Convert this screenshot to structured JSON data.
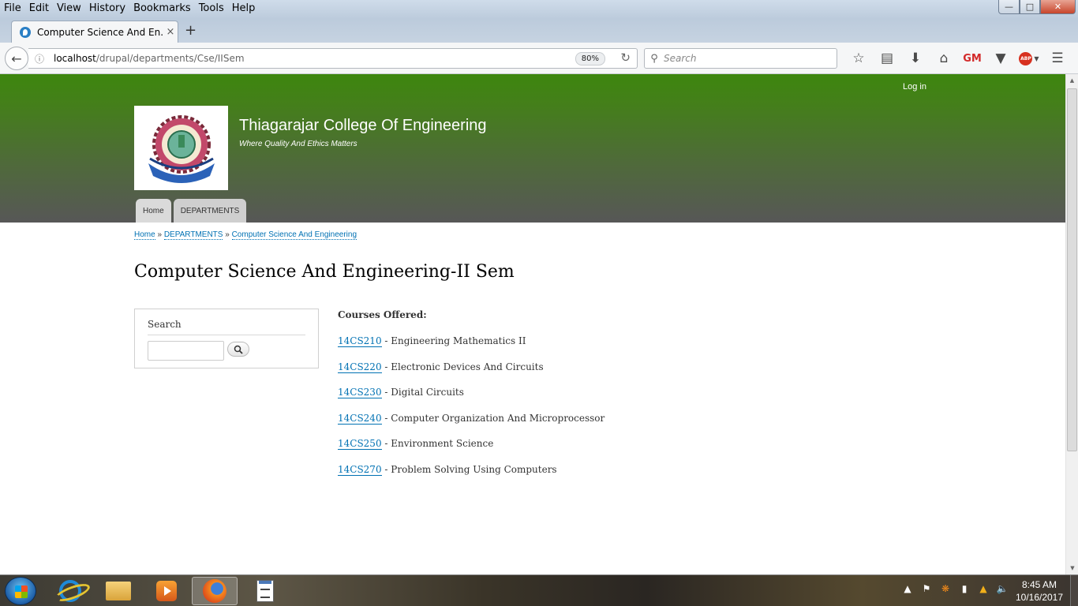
{
  "browser": {
    "menu": [
      "File",
      "Edit",
      "View",
      "History",
      "Bookmarks",
      "Tools",
      "Help"
    ],
    "tab_title": "Computer Science And En...",
    "tab_close": "×",
    "new_tab": "+",
    "url_host": "localhost",
    "url_path": "/drupal/departments/Cse/IISem",
    "zoom": "80%",
    "search_placeholder": "Search",
    "window_controls": {
      "minimize": "—",
      "maximize": "□",
      "close": "✕"
    }
  },
  "site": {
    "login_label": "Log in",
    "name": "Thiagarajar College Of Engineering",
    "slogan": "Where Quality And Ethics Matters",
    "logo_text": "விடியே உயர்",
    "nav": [
      "Home",
      "DEPARTMENTS"
    ]
  },
  "breadcrumb": {
    "items": [
      "Home",
      "DEPARTMENTS",
      "Computer Science And Engineering"
    ],
    "separator": "»"
  },
  "page_title": "Computer Science And Engineering-II Sem",
  "search_block": {
    "title": "Search",
    "value": ""
  },
  "content": {
    "heading": "Courses Offered:",
    "courses": [
      {
        "code": "14CS210",
        "name": " - Engineering Mathematics II"
      },
      {
        "code": "14CS220",
        "name": " - Electronic Devices And Circuits"
      },
      {
        "code": "14CS230",
        "name": " - Digital Circuits"
      },
      {
        "code": "14CS240",
        "name": " - Computer Organization And Microprocessor"
      },
      {
        "code": "14CS250",
        "name": " - Environment Science"
      },
      {
        "code": "14CS270",
        "name": " - Problem Solving Using Computers"
      }
    ]
  },
  "taskbar": {
    "apps": [
      "internet-explorer-icon",
      "folder-icon",
      "media-player-icon",
      "firefox-icon",
      "notepad-icon"
    ],
    "time": "8:45 AM",
    "date": "10/16/2017"
  },
  "colors": {
    "header_top": "#3d860e",
    "header_bottom": "#575757",
    "link": "#0071b3"
  }
}
